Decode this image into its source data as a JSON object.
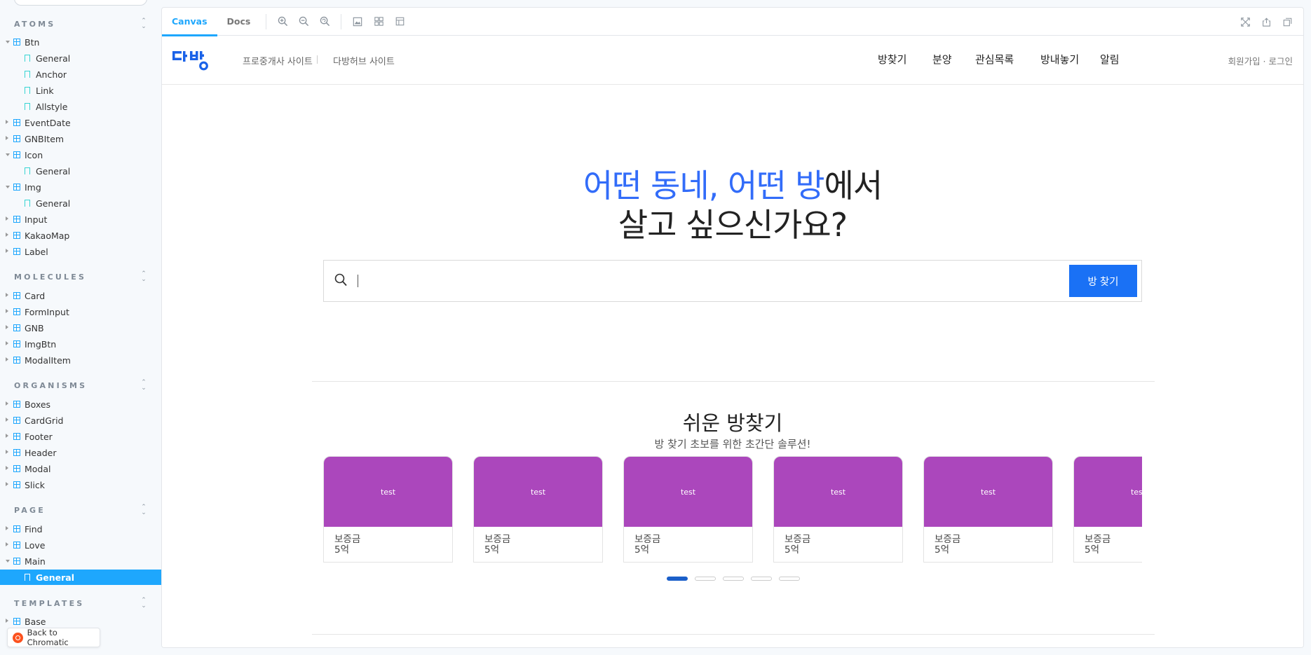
{
  "sidebar": {
    "sections": [
      {
        "title": "ATOMS",
        "items": [
          {
            "label": "Btn",
            "open": true
          },
          {
            "label": "General",
            "story": true
          },
          {
            "label": "Anchor",
            "story": true
          },
          {
            "label": "Link",
            "story": true
          },
          {
            "label": "Allstyle",
            "story": true
          },
          {
            "label": "EventDate"
          },
          {
            "label": "GNBItem"
          },
          {
            "label": "Icon",
            "open": true
          },
          {
            "label": "General",
            "story": true
          },
          {
            "label": "Img",
            "open": true
          },
          {
            "label": "General",
            "story": true
          },
          {
            "label": "Input"
          },
          {
            "label": "KakaoMap"
          },
          {
            "label": "Label"
          }
        ]
      },
      {
        "title": "MOLECULES",
        "items": [
          {
            "label": "Card"
          },
          {
            "label": "FormInput"
          },
          {
            "label": "GNB"
          },
          {
            "label": "ImgBtn"
          },
          {
            "label": "ModalItem"
          }
        ]
      },
      {
        "title": "ORGANISMS",
        "items": [
          {
            "label": "Boxes"
          },
          {
            "label": "CardGrid"
          },
          {
            "label": "Footer"
          },
          {
            "label": "Header"
          },
          {
            "label": "Modal"
          },
          {
            "label": "Slick"
          }
        ]
      },
      {
        "title": "PAGE",
        "items": [
          {
            "label": "Find"
          },
          {
            "label": "Love"
          },
          {
            "label": "Main",
            "open": true
          },
          {
            "label": "General",
            "story": true,
            "selected": true
          }
        ]
      },
      {
        "title": "TEMPLATES",
        "items": [
          {
            "label": "Base"
          }
        ]
      }
    ],
    "chromatic_label": "Back to Chromatic"
  },
  "toolbar": {
    "tabs": [
      {
        "label": "Canvas",
        "active": true
      },
      {
        "label": "Docs",
        "active": false
      }
    ],
    "icons": [
      "zoom-in-icon",
      "zoom-out-icon",
      "zoom-reset-icon",
      "background-icon",
      "grid-icon",
      "measure-icon"
    ],
    "right_icons": [
      "fullscreen-icon",
      "share-icon",
      "copy-link-icon"
    ]
  },
  "site": {
    "logo_alt": "다방",
    "sub_links": [
      "프로중개사 사이트",
      "다방허브 사이트"
    ],
    "nav": [
      "방찾기",
      "분양",
      "관심목록",
      "방내놓기",
      "알림"
    ],
    "auth": "회원가입 · 로그인",
    "hero": {
      "line1_accent": "어떤 동네, 어떤 방",
      "line1_rest": "에서",
      "line2": "살고 싶으신가요?"
    },
    "search": {
      "placeholder": "",
      "button": "방 찾기"
    },
    "easy": {
      "title": "쉬운 방찾기",
      "subtitle": "방 찾기 초보를 위한 초간단 솔루션!"
    },
    "cards": [
      {
        "thumb": "test",
        "label": "보증금",
        "value": "5억"
      },
      {
        "thumb": "test",
        "label": "보증금",
        "value": "5억"
      },
      {
        "thumb": "test",
        "label": "보증금",
        "value": "5억"
      },
      {
        "thumb": "test",
        "label": "보증금",
        "value": "5억"
      },
      {
        "thumb": "test",
        "label": "보증금",
        "value": "5억"
      },
      {
        "thumb": "test",
        "label": "보증금",
        "value": "5억"
      }
    ],
    "slider": {
      "pages": 5,
      "active_index": 0
    },
    "colors": {
      "accent": "#326cf9",
      "button": "#1a71f5",
      "card_thumb": "#ab47bc",
      "storybook_blue": "#1ea7fd"
    }
  }
}
